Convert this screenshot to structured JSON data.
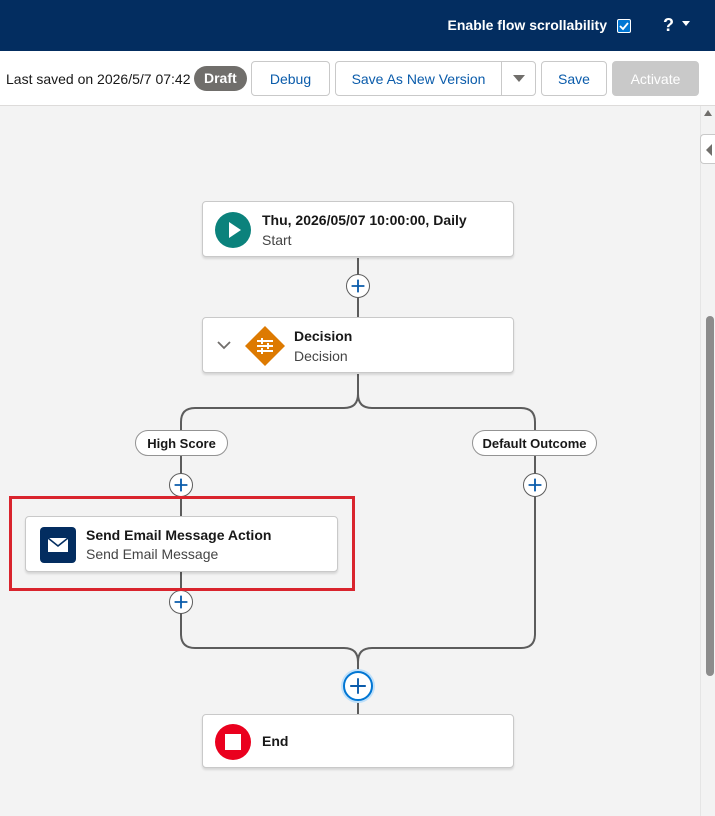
{
  "topbar": {
    "scroll_label": "Enable flow scrollability",
    "scroll_checked": true,
    "help_label": "?"
  },
  "toolbar": {
    "last_saved": "Last saved on 2026/5/7 07:42",
    "status_badge": "Draft",
    "debug_label": "Debug",
    "save_as_new_label": "Save As New Version",
    "save_label": "Save",
    "activate_label": "Activate"
  },
  "flow": {
    "start": {
      "title": "Thu, 2026/05/07 10:00:00, Daily",
      "subtitle": "Start"
    },
    "decision": {
      "title": "Decision",
      "subtitle": "Decision"
    },
    "outcomes": [
      {
        "label": "High Score"
      },
      {
        "label": "Default Outcome"
      }
    ],
    "action": {
      "title": "Send Email Message Action",
      "subtitle": "Send Email Message"
    },
    "end": {
      "title": "End"
    }
  },
  "colors": {
    "brand_header": "#032d60",
    "start_icon": "#0b827c",
    "decision_icon": "#dd7a01",
    "action_icon": "#032d60",
    "end_icon": "#ea001e",
    "highlight": "#d9242d"
  }
}
